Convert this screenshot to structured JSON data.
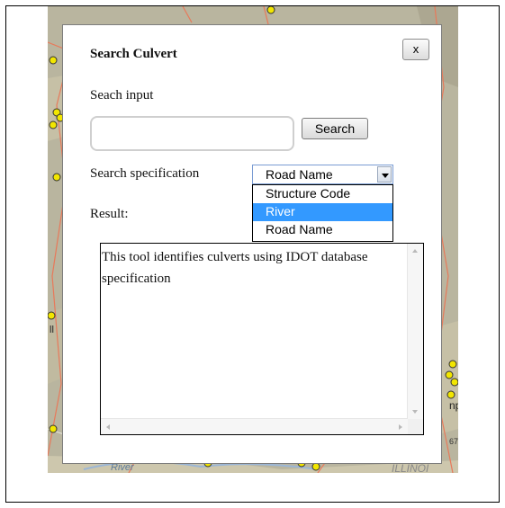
{
  "dialog": {
    "title": "Search Culvert",
    "close_label": "x",
    "search_input_label": "Seach input",
    "search_input_value": "",
    "search_button_label": "Search",
    "spec_label": "Search specification",
    "spec_selected": "Road Name",
    "spec_options": [
      "Structure Code",
      "River",
      "Road Name"
    ],
    "spec_highlighted": "River",
    "result_label": "Result:",
    "result_text": "This tool identifies culverts using IDOT database specification"
  },
  "map": {
    "labels": [
      "River",
      "ILLINOI",
      "np",
      "67",
      "ll"
    ]
  },
  "colors": {
    "map_base": "#b7b39f",
    "marker": "#f2e600",
    "highlight": "#3399ff",
    "road": "#e8795a"
  }
}
